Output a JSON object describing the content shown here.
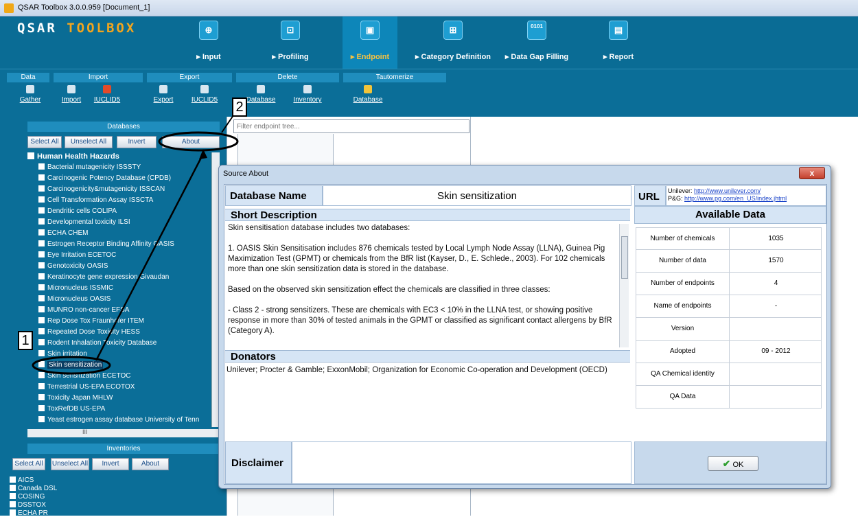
{
  "window": {
    "title": "QSAR Toolbox 3.0.0.959 [Document_1]"
  },
  "logo": {
    "part1": "QSAR",
    "part2": "TOOLBOX"
  },
  "main_tabs": [
    {
      "label": "▸ Input",
      "icon": "⊕"
    },
    {
      "label": "▸ Profiling",
      "icon": "⊡"
    },
    {
      "label": "▸ Endpoint",
      "icon": "▣"
    },
    {
      "label": "▸ Category Definition",
      "icon": "⊞"
    },
    {
      "label": "▸ Data Gap Filling",
      "icon": "0101"
    },
    {
      "label": "▸ Report",
      "icon": "▤"
    }
  ],
  "sub_groups": [
    "Data",
    "Import",
    "Export",
    "Delete",
    "Tautomerize"
  ],
  "sub_buttons": [
    "Gather",
    "Import",
    "IUCLID5",
    "Export",
    "IUCLID5",
    "Database",
    "Inventory",
    "Database"
  ],
  "databases": {
    "title": "Databases",
    "buttons": [
      "Select All",
      "Unselect All",
      "Invert",
      "About"
    ],
    "group": "Human Health Hazards",
    "items": [
      "Bacterial mutagenicity ISSSTY",
      "Carcinogenic Potency Database (CPDB)",
      "Carcinogenicity&mutagenicity ISSCAN",
      "Cell Transformation Assay ISSCTA",
      "Dendritic cells COLIPA",
      "Developmental toxicity ILSI",
      "ECHA CHEM",
      "Estrogen Receptor Binding Affinity OASIS",
      "Eye Irritation ECETOC",
      "Genotoxicity OASIS",
      "Keratinocyte gene expression Givaudan",
      "Micronucleus ISSMIC",
      "Micronucleus OASIS",
      "MUNRO non-cancer EFSA",
      "Rep Dose Tox Fraunhofer ITEM",
      "Repeated Dose Toxicity HESS",
      "Rodent Inhalation Toxicity Database",
      "Skin irritation",
      "Skin sensitization",
      "Skin sensitization ECETOC",
      "Terrestrial US-EPA ECOTOX",
      "Toxicity Japan MHLW",
      "ToxRefDB US-EPA",
      "Yeast estrogen assay database University of Tenn"
    ],
    "hscroll_label": "III"
  },
  "inventories": {
    "title": "Inventories",
    "buttons": [
      "Select All",
      "Unselect All",
      "Invert",
      "About"
    ],
    "items": [
      "AICS",
      "Canada DSL",
      "COSING",
      "DSSTOX",
      "ECHA PR"
    ]
  },
  "filter": {
    "placeholder": "Filter endpoint tree..."
  },
  "dialog": {
    "title": "Source About",
    "close": "x",
    "db_name_label": "Database Name",
    "db_name_value": "Skin sensitization",
    "short_desc_label": "Short   Description",
    "description": [
      "Skin sensitisation database includes two databases:",
      "1.        OASIS Skin Sensitisation includes 876 chemicals tested by Local Lymph Node Assay (LLNA), Guinea Pig Maximization Test (GPMT) or chemicals from the BfR list (Kayser, D., E. Schlede., 2003). For 102 chemicals more than one skin sensitization data is stored in the database.",
      "Based on the observed skin sensitization effect the chemicals are classified in three classes:",
      "-          Class 2 - strong sensitizers.  These are chemicals with EC3 < 10% in the LLNA test, or showing positive response in more than 30% of tested animals in the GPMT or classified as significant contact allergens by BfR (Category A)."
    ],
    "donators_label": "Donators",
    "donators_text": "Unilever; Procter & Gamble; ExxonMobil; Organization for Economic Co-operation and Development (OECD)",
    "disclaimer_label": "Disclaimer",
    "url_label": "URL",
    "urls": [
      {
        "name": "Unilever:",
        "link": "http://www.unilever.com/"
      },
      {
        "name": "P&G:",
        "link": "http://www.pg.com/en_US/index.jhtml"
      }
    ],
    "available_title": "Available Data",
    "available": [
      {
        "key": "Number of chemicals",
        "value": "1035"
      },
      {
        "key": "Number of data",
        "value": "1570"
      },
      {
        "key": "Number of endpoints",
        "value": "4"
      },
      {
        "key": "Name of endpoints",
        "value": "-"
      },
      {
        "key": "Version",
        "value": ""
      },
      {
        "key": "Adopted",
        "value": "09 - 2012"
      },
      {
        "key": "QA Chemical identity",
        "value": ""
      },
      {
        "key": "QA Data",
        "value": ""
      }
    ],
    "ok_label": "OK"
  },
  "annotations": {
    "callout1": "1",
    "callout2": "2"
  },
  "colors": {
    "toolbar": "#0a6c95",
    "accent": "#f2a51e",
    "dialog_bg": "#c7d9ec"
  }
}
